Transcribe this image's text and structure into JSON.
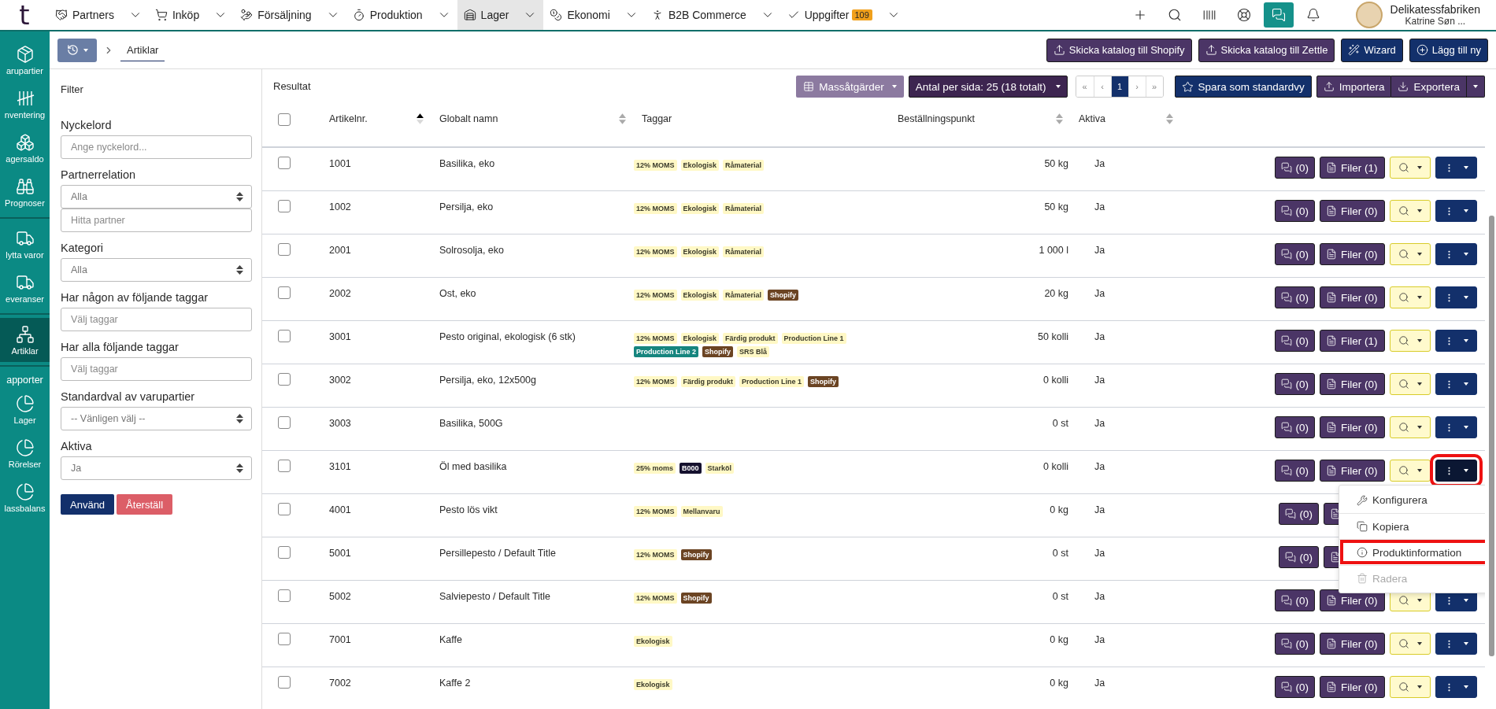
{
  "topnav": {
    "logo": "t",
    "items": [
      {
        "label": "Partners",
        "selected": false
      },
      {
        "label": "Inköp",
        "selected": false
      },
      {
        "label": "Försäljning",
        "selected": false
      },
      {
        "label": "Produktion",
        "selected": false
      },
      {
        "label": "Lager",
        "selected": true
      },
      {
        "label": "Ekonomi",
        "selected": false
      },
      {
        "label": "B2B Commerce",
        "selected": false
      },
      {
        "label": "Uppgifter",
        "selected": false,
        "badge": "109"
      }
    ],
    "tools": [
      {
        "selected": false
      },
      {
        "selected": false
      },
      {
        "selected": false
      },
      {
        "selected": false
      },
      {
        "selected": true
      },
      {
        "selected": false
      }
    ],
    "user": {
      "company": "Delikatessfabriken",
      "name": "Katrine Søn ..."
    }
  },
  "sidebar": {
    "groups": [
      {
        "items": [
          {
            "label": "arupartier",
            "selected": false
          },
          {
            "label": "nventering",
            "selected": false
          },
          {
            "label": "agersaldo",
            "selected": false
          },
          {
            "label": "Prognoser",
            "selected": false
          }
        ]
      },
      {
        "items": [
          {
            "label": "lytta varor",
            "selected": false
          },
          {
            "label": "everanser",
            "selected": false
          }
        ]
      },
      {
        "items": [
          {
            "label": "Artiklar",
            "selected": true
          }
        ]
      },
      {
        "heading": "apporter",
        "items": [
          {
            "label": "Lager",
            "selected": false
          },
          {
            "label": "Rörelser",
            "selected": false
          },
          {
            "label": "lassbalans",
            "selected": false
          }
        ]
      }
    ]
  },
  "breadcrumb": {
    "current": "Artiklar"
  },
  "header_buttons": [
    {
      "label": "Skicka katalog till Shopify",
      "kind": "upload"
    },
    {
      "label": "Skicka katalog till Zettle",
      "kind": "upload"
    },
    {
      "label": "Wizard",
      "kind": "wizard"
    },
    {
      "label": "Lägg till ny",
      "kind": "add"
    }
  ],
  "filter": {
    "title": "Filter",
    "fields": [
      {
        "label": "Nyckelord",
        "controls": [
          {
            "kind": "text",
            "placeholder": "Ange nyckelord..."
          }
        ]
      },
      {
        "label": "Partnerrelation",
        "controls": [
          {
            "kind": "select",
            "value": "Alla"
          },
          {
            "kind": "text",
            "placeholder": "Hitta partner"
          }
        ]
      },
      {
        "label": "Kategori",
        "controls": [
          {
            "kind": "select",
            "value": "Alla"
          }
        ]
      },
      {
        "label": "Har någon av följande taggar",
        "controls": [
          {
            "kind": "text",
            "placeholder": "Välj taggar"
          }
        ]
      },
      {
        "label": "Har alla följande taggar",
        "controls": [
          {
            "kind": "text",
            "placeholder": "Välj taggar"
          }
        ]
      },
      {
        "label": "Standardval av varupartier",
        "controls": [
          {
            "kind": "select",
            "value": "-- Vänligen välj --"
          }
        ]
      },
      {
        "label": "Aktiva",
        "controls": [
          {
            "kind": "select",
            "value": "Ja"
          }
        ]
      }
    ],
    "apply": "Använd",
    "reset": "Återställ"
  },
  "results": {
    "title": "Resultat",
    "mass_actions": "Massåtgärder",
    "per_page": "Antal per sida: 25 (18 totalt)",
    "pagination": [
      {
        "label": "«",
        "selected": false
      },
      {
        "label": "‹",
        "selected": false
      },
      {
        "label": "1",
        "selected": true
      },
      {
        "label": "›",
        "selected": false
      },
      {
        "label": "»",
        "selected": false
      }
    ],
    "save_default": "Spara som standardvy",
    "import": "Importera",
    "export": "Exportera"
  },
  "table": {
    "select_all_checked": false,
    "columns": [
      {
        "label": "Artikelnr.",
        "sortable": true,
        "sorted": true
      },
      {
        "label": "Globalt namn",
        "sortable": true,
        "sorted": false
      },
      {
        "label": "Taggar",
        "sortable": false
      },
      {
        "label": "Beställningspunkt",
        "sortable": true,
        "sorted": false
      },
      {
        "label": "Aktiva",
        "sortable": true,
        "sorted": false
      }
    ],
    "rows": [
      {
        "checked": false,
        "number": "1001",
        "name": "Basilika, eko",
        "tags": [
          {
            "label": "12% MOMS",
            "color": "#fff8c5"
          },
          {
            "label": "Ekologisk",
            "color": "#fff8c5"
          },
          {
            "label": "Råmaterial",
            "color": "#fff8c5"
          }
        ],
        "order_point": "50 kg",
        "active": "Ja",
        "comments": "(0)",
        "files": "Filer (1)",
        "menu_open": false
      },
      {
        "checked": false,
        "number": "1002",
        "name": "Persilja, eko",
        "tags": [
          {
            "label": "12% MOMS",
            "color": "#fff8c5"
          },
          {
            "label": "Ekologisk",
            "color": "#fff8c5"
          },
          {
            "label": "Råmaterial",
            "color": "#fff8c5"
          }
        ],
        "order_point": "50 kg",
        "active": "Ja",
        "comments": "(0)",
        "files": "Filer (0)",
        "menu_open": false
      },
      {
        "checked": false,
        "number": "2001",
        "name": "Solrosolja, eko",
        "tags": [
          {
            "label": "12% MOMS",
            "color": "#fff8c5"
          },
          {
            "label": "Ekologisk",
            "color": "#fff8c5"
          },
          {
            "label": "Råmaterial",
            "color": "#fff8c5"
          }
        ],
        "order_point": "1 000 l",
        "active": "Ja",
        "comments": "(0)",
        "files": "Filer (0)",
        "menu_open": false
      },
      {
        "checked": false,
        "number": "2002",
        "name": "Ost, eko",
        "tags": [
          {
            "label": "12% MOMS",
            "color": "#fff8c5"
          },
          {
            "label": "Ekologisk",
            "color": "#fff8c5"
          },
          {
            "label": "Råmaterial",
            "color": "#fff8c5"
          },
          {
            "label": "Shopify",
            "color": "#6b4423"
          }
        ],
        "order_point": "20 kg",
        "active": "Ja",
        "comments": "(0)",
        "files": "Filer (0)",
        "menu_open": false
      },
      {
        "checked": false,
        "number": "3001",
        "name": "Pesto original, ekologisk (6 stk)",
        "tags": [
          {
            "label": "12% MOMS",
            "color": "#fff8c5"
          },
          {
            "label": "Ekologisk",
            "color": "#fff8c5"
          },
          {
            "label": "Färdig produkt",
            "color": "#fff8c5"
          },
          {
            "label": "Production Line 1",
            "color": "#fff8c5"
          },
          {
            "label": "Production Line 2",
            "color": "#15857e"
          },
          {
            "label": "Shopify",
            "color": "#6b4423"
          },
          {
            "label": "SRS Blå",
            "color": "#fff8c5"
          }
        ],
        "order_point": "50 kolli",
        "active": "Ja",
        "comments": "(0)",
        "files": "Filer (1)",
        "menu_open": false
      },
      {
        "checked": false,
        "number": "3002",
        "name": "Persilja, eko, 12x500g",
        "tags": [
          {
            "label": "12% MOMS",
            "color": "#fff8c5"
          },
          {
            "label": "Färdig produkt",
            "color": "#fff8c5"
          },
          {
            "label": "Production Line 1",
            "color": "#fff8c5"
          },
          {
            "label": "Shopify",
            "color": "#6b4423"
          }
        ],
        "order_point": "0 kolli",
        "active": "Ja",
        "comments": "(0)",
        "files": "Filer (0)",
        "menu_open": false
      },
      {
        "checked": false,
        "number": "3003",
        "name": "Basilika, 500G",
        "tags": [],
        "order_point": "0 st",
        "active": "Ja",
        "comments": "(0)",
        "files": "Filer (0)",
        "menu_open": false
      },
      {
        "checked": false,
        "number": "3101",
        "name": "Öl med basilika",
        "tags": [
          {
            "label": "25% moms",
            "color": "#fff8c5"
          },
          {
            "label": "B000",
            "color": "#15112e"
          },
          {
            "label": "Starköl",
            "color": "#fff8c5"
          }
        ],
        "order_point": "0 kolli",
        "active": "Ja",
        "comments": "(0)",
        "files": "Filer (0)",
        "menu_open": true
      },
      {
        "checked": false,
        "number": "4001",
        "name": "Pesto lös vikt",
        "tags": [
          {
            "label": "12% MOMS",
            "color": "#fff8c5"
          },
          {
            "label": "Mellanvaru",
            "color": "#fff8c5"
          }
        ],
        "order_point": "0 kg",
        "active": "Ja",
        "comments": "(0)",
        "menu_open": false
      },
      {
        "checked": false,
        "number": "5001",
        "name": "Persillepesto / Default Title",
        "tags": [
          {
            "label": "12% MOMS",
            "color": "#fff8c5"
          },
          {
            "label": "Shopify",
            "color": "#6b4423"
          }
        ],
        "order_point": "0 st",
        "active": "Ja",
        "comments": "(0)",
        "menu_open": false
      },
      {
        "checked": false,
        "number": "5002",
        "name": "Salviepesto / Default Title",
        "tags": [
          {
            "label": "12% MOMS",
            "color": "#fff8c5"
          },
          {
            "label": "Shopify",
            "color": "#6b4423"
          }
        ],
        "order_point": "0 st",
        "active": "Ja",
        "comments": "(0)",
        "files": "Filer (0)",
        "menu_open": false
      },
      {
        "checked": false,
        "number": "7001",
        "name": "Kaffe",
        "tags": [
          {
            "label": "Ekologisk",
            "color": "#fff8c5"
          }
        ],
        "order_point": "0 kg",
        "active": "Ja",
        "comments": "(0)",
        "files": "Filer (0)",
        "menu_open": false
      },
      {
        "checked": false,
        "number": "7002",
        "name": "Kaffe 2",
        "tags": [
          {
            "label": "Ekologisk",
            "color": "#fff8c5"
          }
        ],
        "order_point": "0 kg",
        "active": "Ja",
        "comments": "(0)",
        "files": "Filer (0)",
        "menu_open": false
      }
    ]
  },
  "row_menu": [
    {
      "label": "Konfigurera",
      "disabled": false,
      "highlighted": false
    },
    {
      "label": "Kopiera",
      "disabled": false,
      "highlighted": false
    },
    {
      "label": "Produktinformation",
      "disabled": false,
      "highlighted": true
    },
    {
      "label": "Radera",
      "disabled": true,
      "highlighted": false
    }
  ]
}
